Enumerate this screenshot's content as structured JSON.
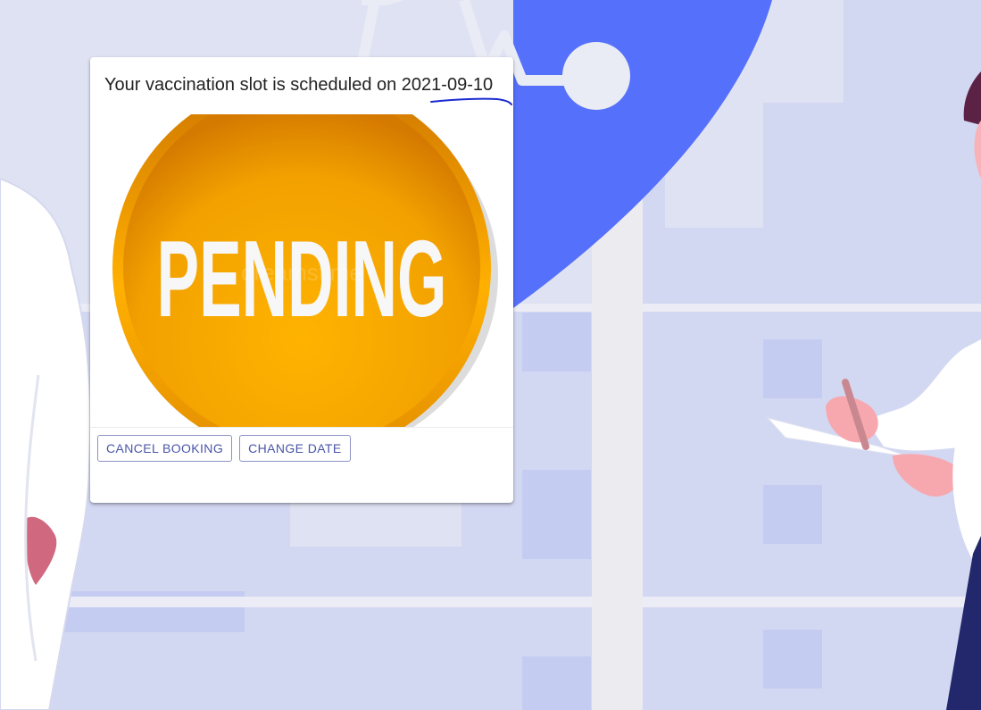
{
  "card": {
    "title": "Your vaccination slot is scheduled on 2021-09-10",
    "status_image_text": "PENDING",
    "status_image_watermark": "dreamstime",
    "actions": {
      "cancel_label": "CANCEL BOOKING",
      "change_label": "CHANGE DATE"
    }
  },
  "colors": {
    "background": "#dfe2f3",
    "accent_blue": "#5570fb",
    "pending_orange": "#f4a300",
    "button_text": "#4a55a8",
    "annotation_ink": "#1a2ad0"
  },
  "icons": {
    "background": "medical-illustration"
  }
}
